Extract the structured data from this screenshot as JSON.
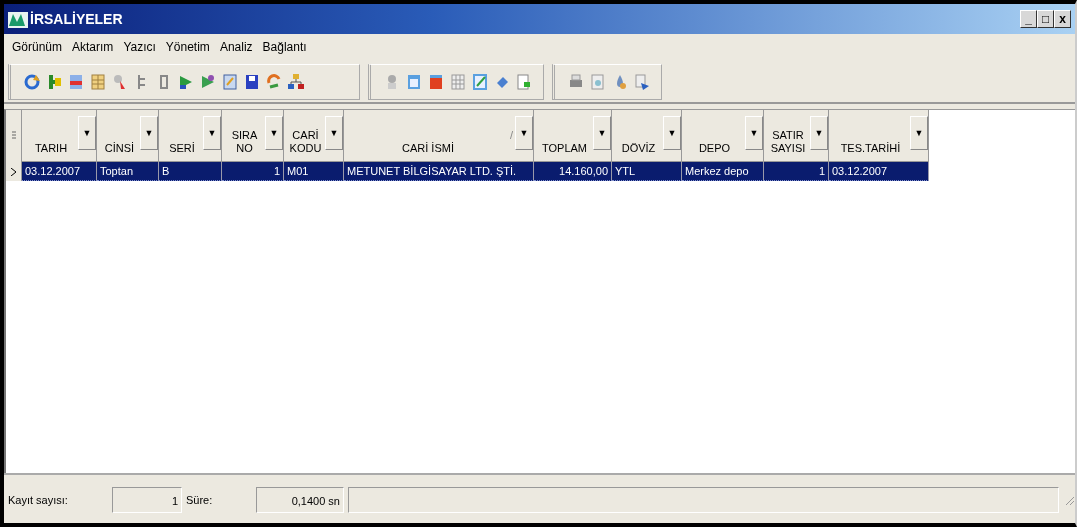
{
  "window": {
    "title": "İRSALİYELER",
    "controls": [
      "_",
      "□",
      "x"
    ]
  },
  "menu": [
    "Görünüm",
    "Aktarım",
    "Yazıcı",
    "Yönetim",
    "Analiz",
    "Bağlantı"
  ],
  "table": {
    "columns": [
      {
        "label": "TARIH",
        "filter": "▼"
      },
      {
        "label": "CİNSİ",
        "filter": "▼"
      },
      {
        "label": "SERİ",
        "filter": "▼"
      },
      {
        "label": "SIRA NO",
        "filter": "▼"
      },
      {
        "label": "CARİ KODU",
        "filter": "▼"
      },
      {
        "label": "CARİ İSMİ",
        "sort_mark": "/",
        "filter": "▼"
      },
      {
        "label": "TOPLAM",
        "filter": "▼"
      },
      {
        "label": "DÖVİZ",
        "filter": "▼"
      },
      {
        "label": "DEPO",
        "filter": "▼"
      },
      {
        "label": "SATIR SAYISI",
        "filter": "▼"
      },
      {
        "label": "TES.TARİHİ",
        "filter": "▼"
      }
    ],
    "rows": [
      {
        "selected": true,
        "cells": [
          "03.12.2007",
          "Toptan",
          "B",
          "1",
          "M01",
          "METUNET BİLGİSAYAR LTD. ŞTİ.",
          "14.160,00",
          "YTL",
          "Merkez depo",
          "1",
          "03.12.2007"
        ]
      }
    ]
  },
  "status_bar": {
    "record_label": "Kayıt sayısı:",
    "record_count": "1",
    "time_label": "Süre:",
    "time_value": "0,1400 sn"
  }
}
